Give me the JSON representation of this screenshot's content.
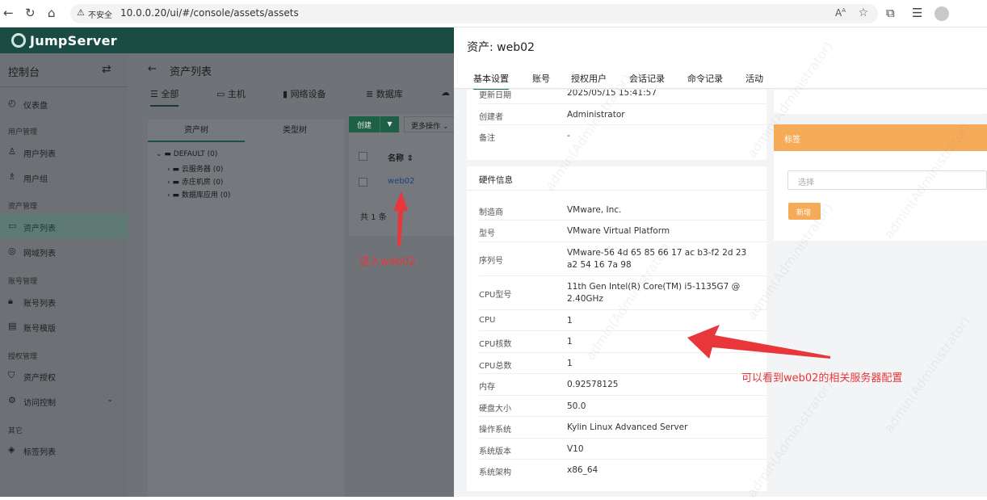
{
  "browser": {
    "insecure_label": "不安全",
    "url": "10.0.0.20/ui/#/console/assets/assets"
  },
  "app": {
    "logo_text": "JumpServer",
    "brand_color": "#1b4c43",
    "accent_color": "#1b6b57"
  },
  "sidebar": {
    "title": "控制台",
    "items": [
      {
        "label": "仪表盘",
        "icon": "dashboard-icon"
      },
      {
        "group": "用户管理"
      },
      {
        "label": "用户列表",
        "icon": "user-icon"
      },
      {
        "label": "用户组",
        "icon": "user-group-icon"
      },
      {
        "group": "资产管理"
      },
      {
        "label": "资产列表",
        "icon": "asset-icon",
        "active": true
      },
      {
        "label": "网域列表",
        "icon": "zone-icon"
      },
      {
        "group": "账号管理"
      },
      {
        "label": "账号列表",
        "icon": "lock-icon"
      },
      {
        "label": "账号模版",
        "icon": "template-icon"
      },
      {
        "group": "授权管理"
      },
      {
        "label": "资产授权",
        "icon": "shield-icon"
      },
      {
        "label": "访问控制",
        "icon": "access-icon"
      },
      {
        "group": "其它"
      },
      {
        "label": "标签列表",
        "icon": "tag-icon"
      }
    ]
  },
  "main": {
    "title": "资产列表",
    "tabs": [
      "全部",
      "主机",
      "网络设备",
      "数据库"
    ],
    "tree_tabs": [
      "资产树",
      "类型树"
    ],
    "tree": {
      "root": "DEFAULT (0)",
      "children": [
        "云服务器 (0)",
        "赤庄机房 (0)",
        "数据库应用 (0)"
      ]
    },
    "create_label": "创建",
    "more_label": "更多操作",
    "name_header": "名称",
    "asset_link": "web02",
    "total": "共 1 条"
  },
  "annotations": {
    "enter": "进入web02",
    "note": "可以看到web02的相关服务器配置"
  },
  "drawer": {
    "title": "资产: web02",
    "tabs": [
      "基本设置",
      "账号",
      "授权用户",
      "会话记录",
      "命令记录",
      "活动"
    ],
    "basic_rows": [
      {
        "key": "更新日期",
        "value": "2025/05/15 15:41:57"
      },
      {
        "key": "创建者",
        "value": "Administrator"
      },
      {
        "key": "备注",
        "value": "-"
      }
    ],
    "hardware_title": "硬件信息",
    "hardware_rows": [
      {
        "key": "制造商",
        "value": "VMware, Inc."
      },
      {
        "key": "型号",
        "value": "VMware Virtual Platform"
      },
      {
        "key": "序列号",
        "value": "VMware-56 4d 65 85 66 17 ac b3-f2 2d 23 a2 54 16 7a 98"
      },
      {
        "key": "CPU型号",
        "value": "11th Gen Intel(R) Core(TM) i5-1135G7 @ 2.40GHz"
      },
      {
        "key": "CPU",
        "value": "1"
      },
      {
        "key": "CPU核数",
        "value": "1"
      },
      {
        "key": "CPU总数",
        "value": "1"
      },
      {
        "key": "内存",
        "value": "0.92578125"
      },
      {
        "key": "硬盘大小",
        "value": "50.0"
      },
      {
        "key": "操作系统",
        "value": "Kylin Linux Advanced Server"
      },
      {
        "key": "系统版本",
        "value": "V10"
      },
      {
        "key": "系统架构",
        "value": "x86_64"
      }
    ],
    "tag_card": {
      "title": "标签",
      "select_placeholder": "选择",
      "add_label": "新增",
      "header_color": "#f5ab58"
    },
    "watermark": "admin(Administrator)"
  }
}
